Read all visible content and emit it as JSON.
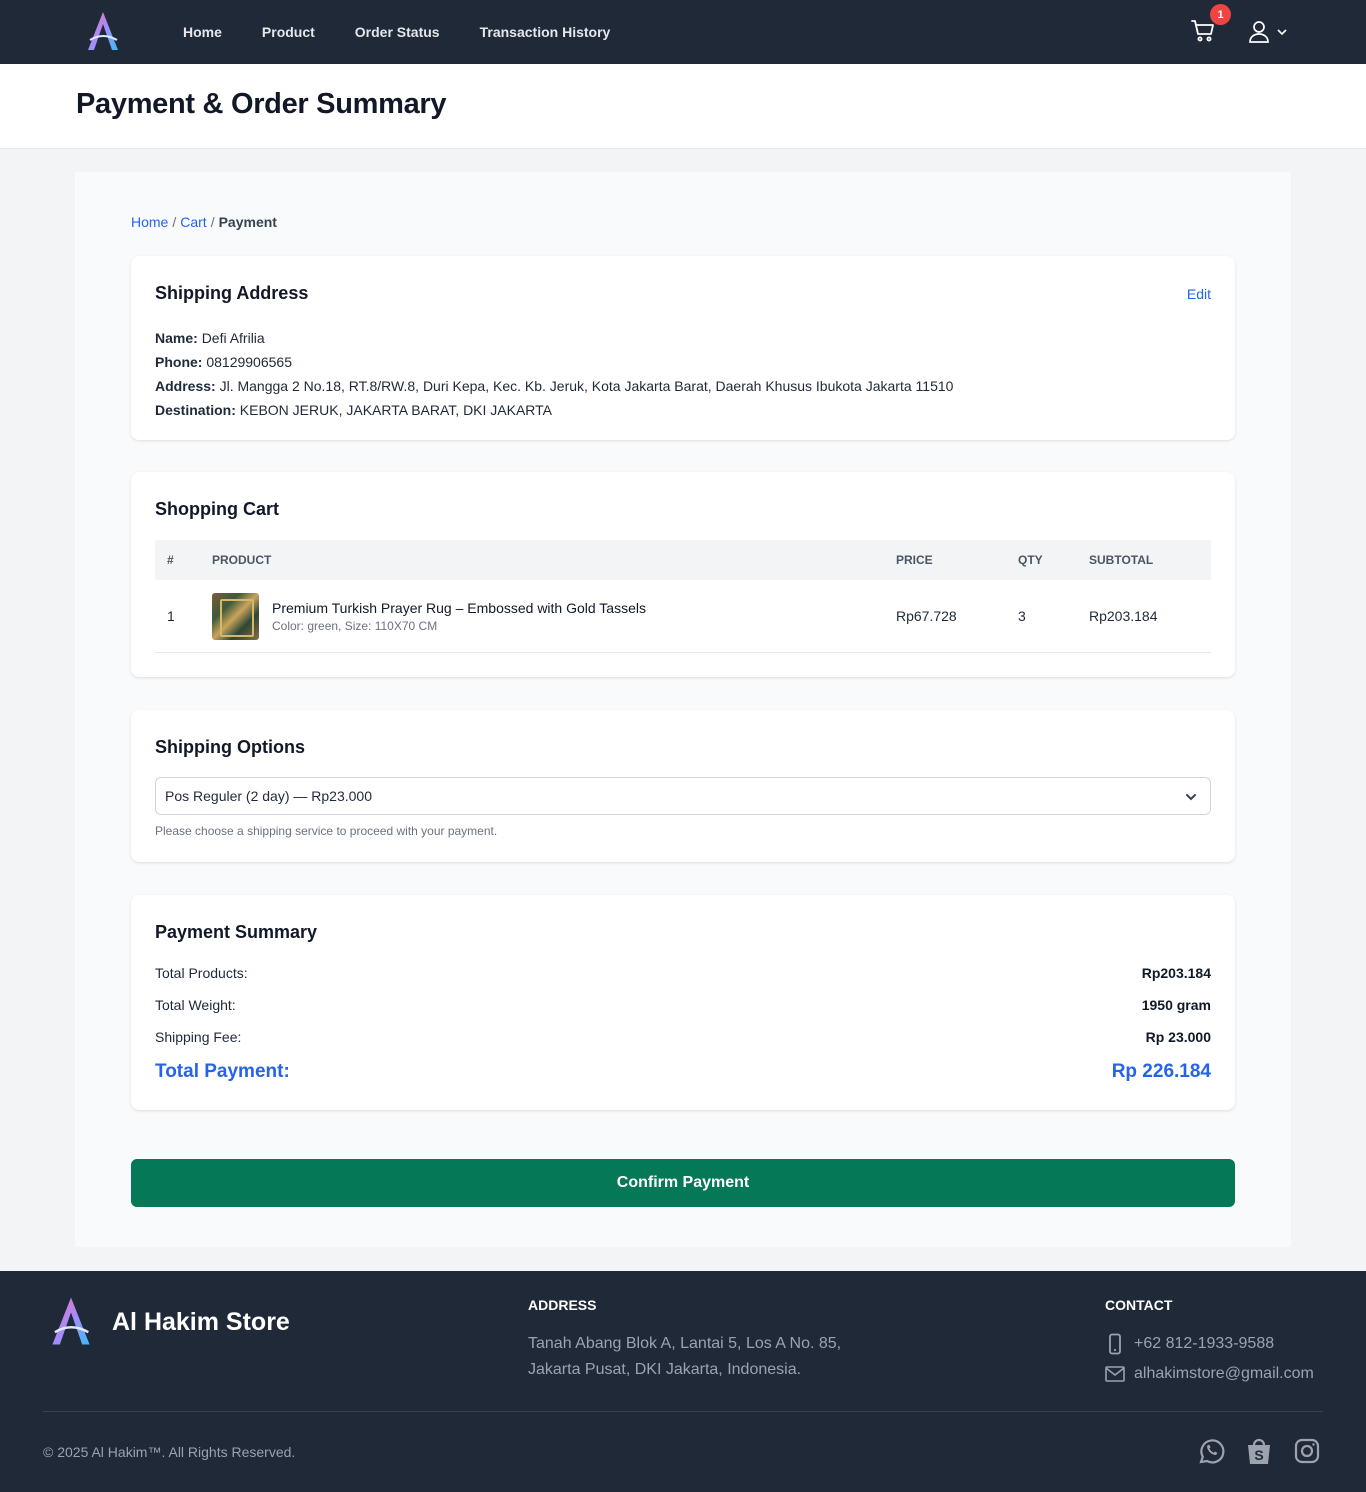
{
  "nav": {
    "links": [
      "Home",
      "Product",
      "Order Status",
      "Transaction History"
    ],
    "cart_count": "1",
    "colors": {
      "bg": "#1f2937",
      "badge": "#ef4444"
    }
  },
  "header": {
    "title": "Payment & Order Summary"
  },
  "breadcrumb": {
    "home": "Home",
    "cart": "Cart",
    "current": "Payment",
    "separator": "/"
  },
  "shipping_address": {
    "title": "Shipping Address",
    "edit_label": "Edit",
    "name_label": "Name:",
    "name": "Defi Afrilia",
    "phone_label": "Phone:",
    "phone": "08129906565",
    "address_label": "Address:",
    "address": "Jl. Mangga 2 No.18, RT.8/RW.8, Duri Kepa, Kec. Kb. Jeruk, Kota Jakarta Barat, Daerah Khusus Ibukota Jakarta 11510",
    "destination_label": "Destination:",
    "destination": "KEBON JERUK, JAKARTA BARAT, DKI JAKARTA"
  },
  "cart": {
    "title": "Shopping Cart",
    "columns": [
      "#",
      "PRODUCT",
      "PRICE",
      "QTY",
      "SUBTOTAL"
    ],
    "rows": [
      {
        "index": "1",
        "name": "Premium Turkish Prayer Rug – Embossed with Gold Tassels",
        "variant": "Color: green, Size: 110X70 CM",
        "price": "Rp67.728",
        "qty": "3",
        "subtotal": "Rp203.184"
      }
    ]
  },
  "shipping_options": {
    "title": "Shipping Options",
    "selected": "Pos Reguler (2 day) — Rp23.000",
    "help": "Please choose a shipping service to proceed with your payment."
  },
  "payment_summary": {
    "title": "Payment Summary",
    "total_products_label": "Total Products:",
    "total_products": "Rp203.184",
    "total_weight_label": "Total Weight:",
    "total_weight": "1950 gram",
    "shipping_fee_label": "Shipping Fee:",
    "shipping_fee": "Rp 23.000",
    "total_payment_label": "Total Payment:",
    "total_payment": "Rp 226.184",
    "accent": "#2563eb"
  },
  "confirm_label": "Confirm Payment",
  "confirm_color": "#047857",
  "footer": {
    "brand": "Al Hakim Store",
    "address_heading": "ADDRESS",
    "address_line1": "Tanah Abang Blok A, Lantai 5, Los A No. 85,",
    "address_line2": "Jakarta Pusat, DKI Jakarta, Indonesia.",
    "contact_heading": "CONTACT",
    "phone": "+62 812-1933-9588",
    "email": "alhakimstore@gmail.com",
    "copyright": "© 2025 Al Hakim™. All Rights Reserved.",
    "social_icons": [
      "whatsapp-icon",
      "shopee-icon",
      "instagram-icon"
    ]
  }
}
